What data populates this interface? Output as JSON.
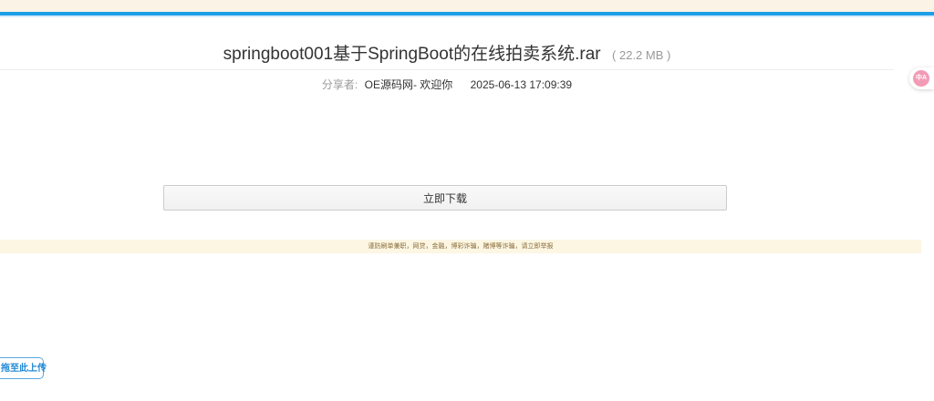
{
  "file": {
    "title": "springboot001基于SpringBoot的在线拍卖系统.rar",
    "size": "( 22.2 MB )"
  },
  "meta": {
    "sharer_label": "分享者:",
    "sharer_name": "OE源码网- 欢迎你",
    "timestamp": "2025-06-13 17:09:39"
  },
  "actions": {
    "download_label": "立即下载"
  },
  "warning": {
    "text": "谨防刷单兼职，网贷，金融，博彩诈骗，赌博等诈骗，请立即举报"
  },
  "widgets": {
    "translate_icon": "中A",
    "upload_label": "拖至此上传"
  },
  "colors": {
    "accent": "#1e9ee6",
    "top_strip": "#fbf3e6",
    "warning_bg": "#fcf6e3",
    "warning_text": "#8a6d3b",
    "translate_icon_bg": "#f29bb7"
  }
}
